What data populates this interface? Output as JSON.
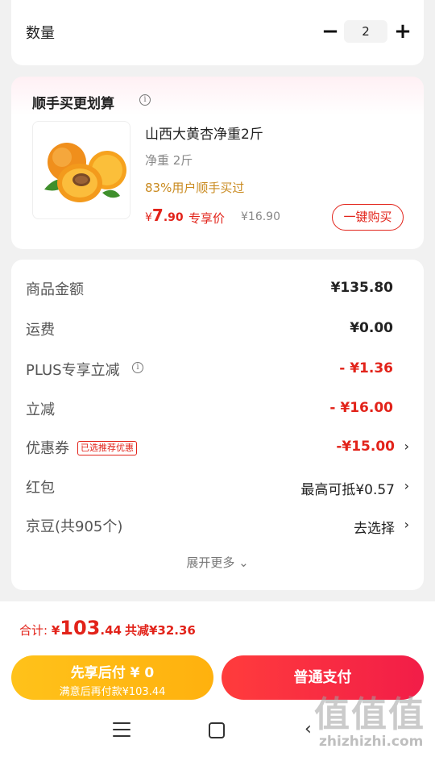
{
  "quantity": {
    "label": "数量",
    "minus": "−",
    "value": "2",
    "plus": "+"
  },
  "addon": {
    "title": "顺手买更划算",
    "info_icon": "i",
    "name": "山西大黄杏净重2斤",
    "spec": "净重 2斤",
    "users": "83%用户顺手买过",
    "price_yen": "¥",
    "price_int": "7",
    "price_dec": ".90",
    "exclusive": "专享价",
    "original_price": "¥16.90",
    "buy_button": "一键购买"
  },
  "summary": {
    "rows": [
      {
        "label": "商品金额",
        "value": "¥135.80"
      },
      {
        "label": "运费",
        "value": "¥0.00"
      },
      {
        "label": "PLUS专享立减",
        "value": "- ¥1.36"
      },
      {
        "label": "立减",
        "value": "- ¥16.00"
      },
      {
        "label": "优惠券",
        "badge": "已选推荐优惠",
        "value": "-¥15.00"
      },
      {
        "label": "红包",
        "value": "最高可抵¥0.57"
      },
      {
        "label": "京豆(共905个)",
        "value": "去选择"
      }
    ],
    "chevron": "›",
    "expand": "展开更多 ⌄"
  },
  "bottom": {
    "total_label": "合计: ",
    "total_yen": "¥",
    "total_int": "103",
    "total_dec": ".44",
    "total_saved": "共减¥32.36",
    "pay_later_title": "先享后付 ¥ 0",
    "pay_later_sub": "满意后再付款¥103.44",
    "pay_normal": "普通支付"
  },
  "nav": {
    "back": "‹"
  },
  "watermark": {
    "glyphs": "值值值",
    "text": "zhizhizhi.com"
  },
  "colors": {
    "accent_red": "#e2231a",
    "pay_later": "#ffb10e",
    "pay_normal": "#f21d48",
    "users_gold": "#c98a1f"
  },
  "icons": [
    "info-icon",
    "chevron-right-icon",
    "chevron-down-icon",
    "menu-icon",
    "home-icon",
    "back-icon"
  ]
}
